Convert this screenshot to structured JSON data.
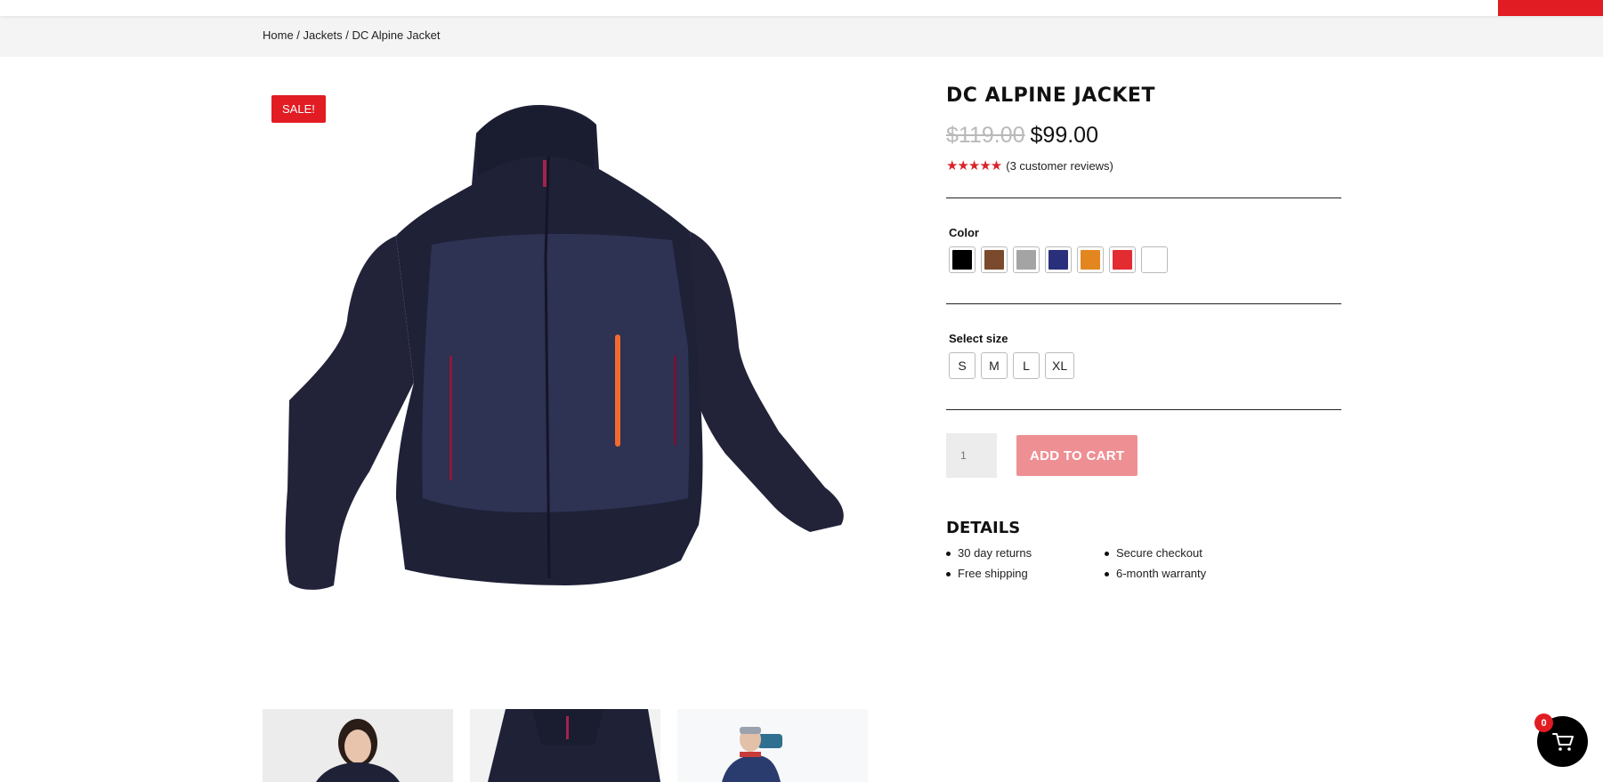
{
  "header": {
    "accent_color": "#e21c23"
  },
  "breadcrumb": {
    "items": [
      "Home",
      "Jackets",
      "DC Alpine Jacket"
    ],
    "separator": " / "
  },
  "gallery": {
    "badge": "SALE!",
    "main_image": "navy-jacket-product-photo",
    "thumbnails": [
      "model-front-photo",
      "jacket-collar-closeup-photo",
      "hiker-outdoor-photo"
    ]
  },
  "product": {
    "title": "DC ALPINE JACKET",
    "price_old": "$119.00",
    "price_new": "$99.00",
    "rating": 5,
    "stars": "★★★★★",
    "reviews_text": "(3 customer reviews)"
  },
  "color_option": {
    "label": "Color",
    "swatches": [
      {
        "name": "black",
        "hex": "#000000"
      },
      {
        "name": "brown",
        "hex": "#7b4a2c"
      },
      {
        "name": "grey",
        "hex": "#a4a4a4"
      },
      {
        "name": "navy",
        "hex": "#2a2f7c"
      },
      {
        "name": "orange",
        "hex": "#e3861f"
      },
      {
        "name": "red",
        "hex": "#e22c31"
      },
      {
        "name": "white",
        "hex": "#ffffff"
      }
    ]
  },
  "size_option": {
    "label": "Select size",
    "sizes": [
      "S",
      "M",
      "L",
      "XL"
    ]
  },
  "cart": {
    "quantity": "1",
    "add_label": "ADD TO CART",
    "count": "0"
  },
  "details": {
    "title": "DETAILS",
    "items": [
      "30 day returns",
      "Secure checkout",
      "Free shipping",
      "6-month warranty"
    ]
  }
}
